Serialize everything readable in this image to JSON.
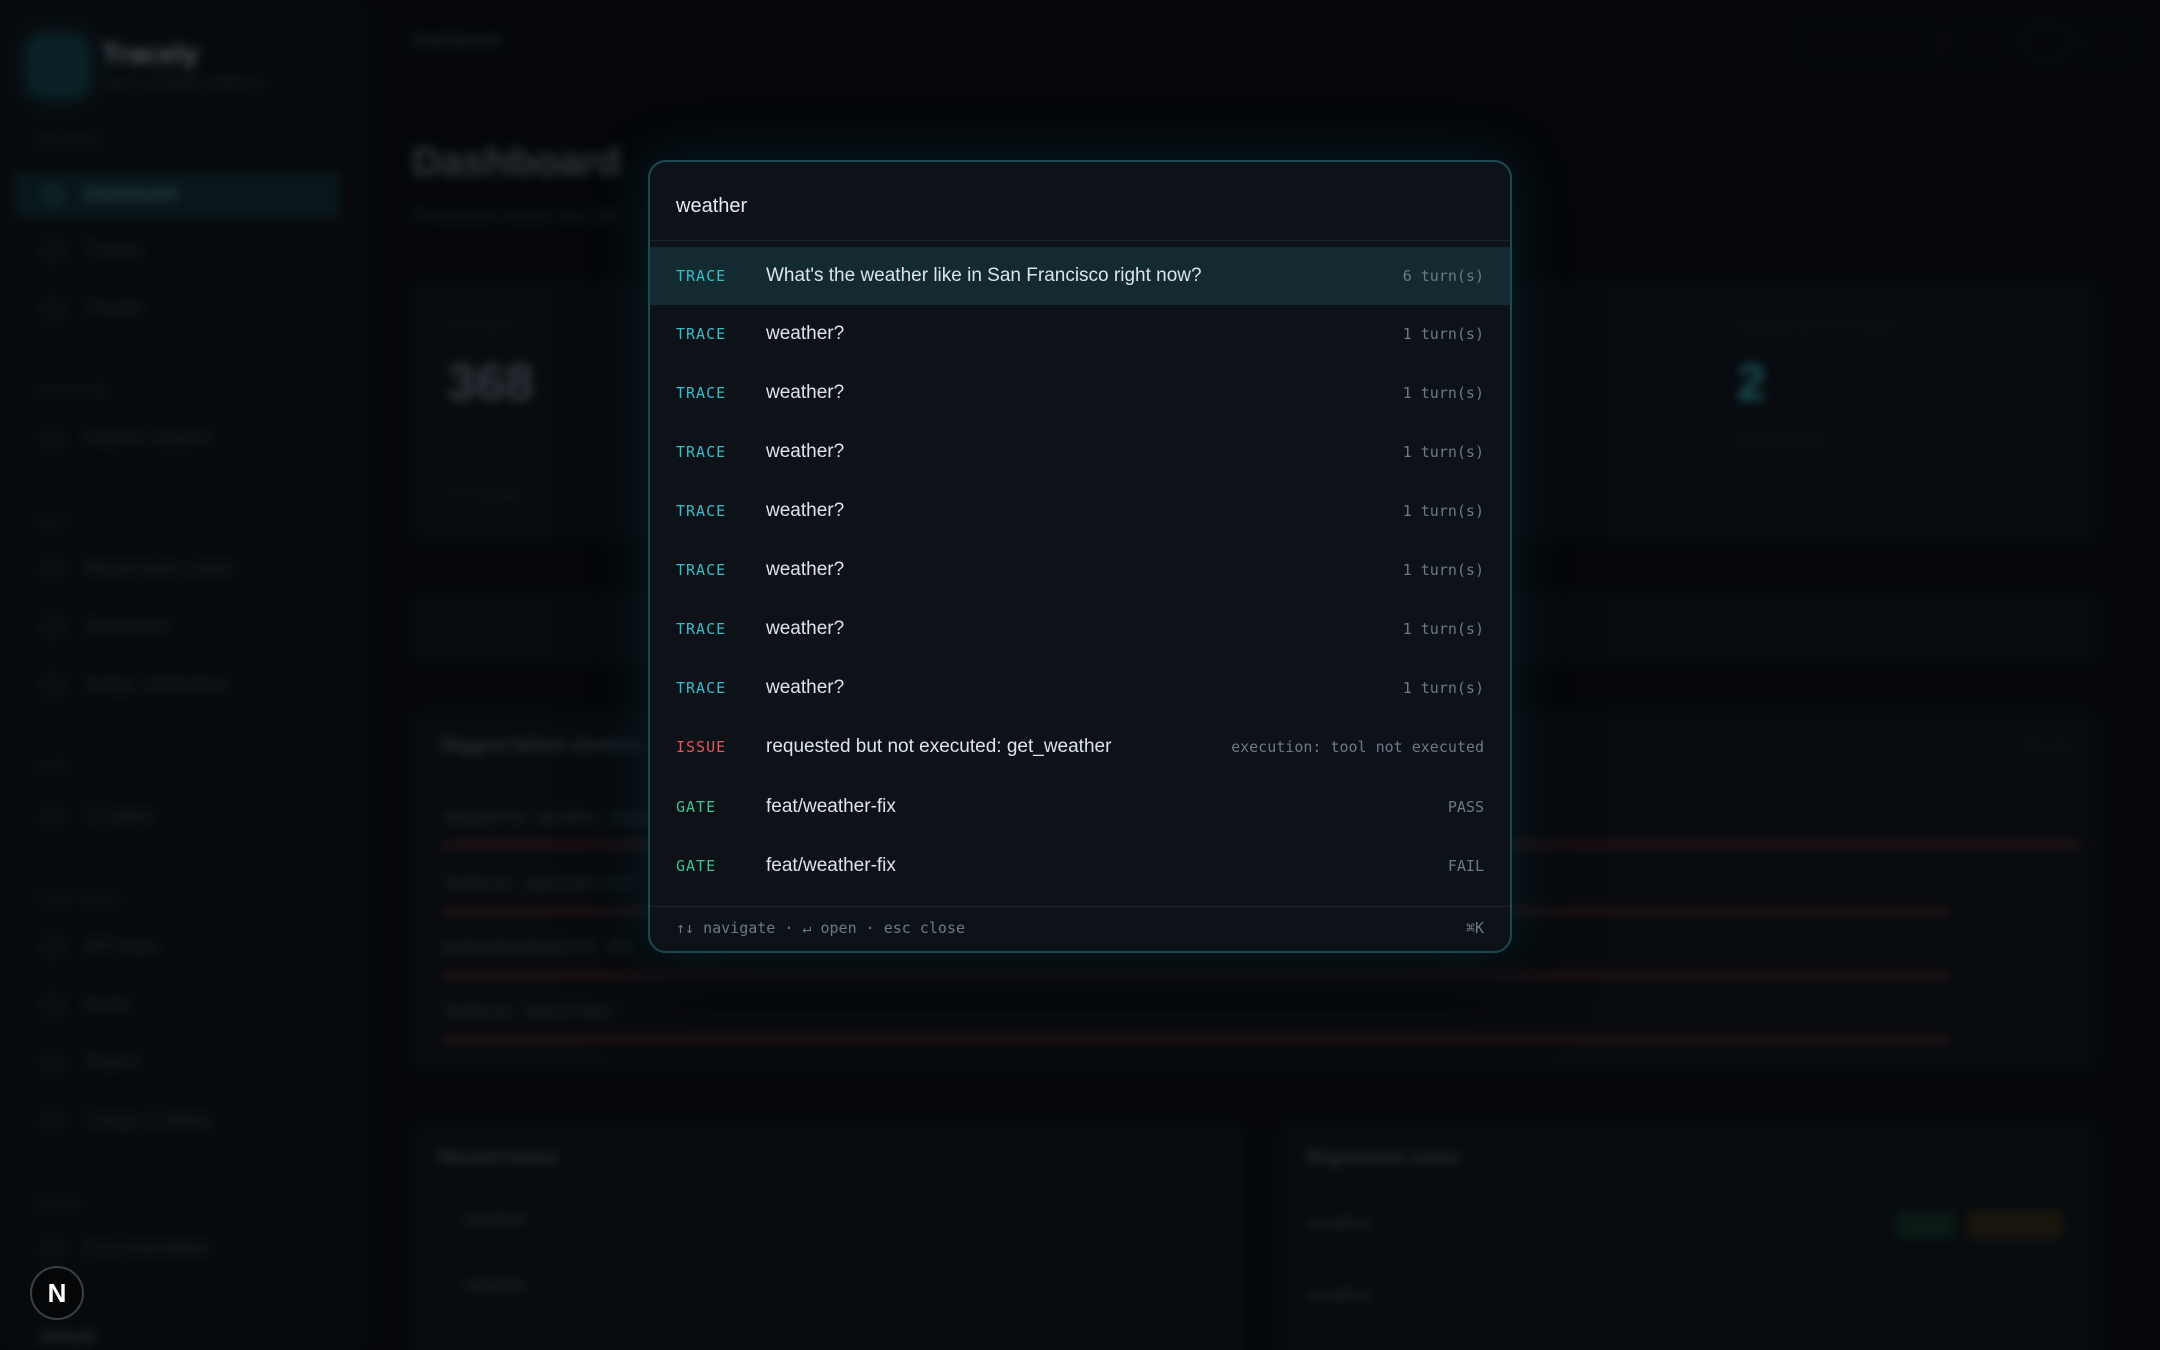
{
  "app": {
    "name": "Tracely",
    "tagline": "Agent reliability platform"
  },
  "sidebar": {
    "groups": [
      {
        "label": "OBSERVE",
        "items": [
          "Dashboard",
          "Traces",
          "Trends"
        ]
      },
      {
        "label": "DIAGNOSE",
        "items": [
          "Failure clusters"
        ]
      },
      {
        "label": "TEST",
        "items": [
          "Regression cases",
          "Scenarios",
          "Judge calibration"
        ]
      },
      {
        "label": "SHIP",
        "items": [
          "CI gates"
        ]
      },
      {
        "label": "CONFIGURE",
        "items": [
          "API keys",
          "Evals",
          "Teams",
          "Usage & billing"
        ]
      },
      {
        "label": "LEARN",
        "items": [
          "Documentation"
        ]
      }
    ],
    "user": "Default"
  },
  "header": {
    "breadcrumb": "Dashboard",
    "search_label": "Search"
  },
  "dashboard": {
    "title": "Dashboard",
    "subtitle": "Production traces last 24h",
    "stats": [
      {
        "label": "TRACES",
        "value": "368",
        "note": "375 spans"
      },
      {
        "label": "REGRESSION CASES",
        "value": "2",
        "note": "Ground truth"
      }
    ],
    "failures_title": "Biggest failure clusters",
    "view_all": "View all",
    "failures": [
      "ValueError: weather_forecast",
      "ToolError: upstream 502",
      "AuthenticationError: 401",
      "ToolError: rate limited"
    ],
    "recent_title": "Recent traces",
    "regression_title": "Regression cases",
    "recent_rows": [
      "weather",
      "weather"
    ],
    "regression_rows": [
      "weather",
      "weather"
    ]
  },
  "palette": {
    "query": "weather",
    "results": [
      {
        "tag": "TRACE",
        "text": "What's the weather like in San Francisco right now?",
        "meta": "6 turn(s)"
      },
      {
        "tag": "TRACE",
        "text": "weather?",
        "meta": "1 turn(s)"
      },
      {
        "tag": "TRACE",
        "text": "weather?",
        "meta": "1 turn(s)"
      },
      {
        "tag": "TRACE",
        "text": "weather?",
        "meta": "1 turn(s)"
      },
      {
        "tag": "TRACE",
        "text": "weather?",
        "meta": "1 turn(s)"
      },
      {
        "tag": "TRACE",
        "text": "weather?",
        "meta": "1 turn(s)"
      },
      {
        "tag": "TRACE",
        "text": "weather?",
        "meta": "1 turn(s)"
      },
      {
        "tag": "TRACE",
        "text": "weather?",
        "meta": "1 turn(s)"
      },
      {
        "tag": "ISSUE",
        "text": "requested but not executed: get_weather",
        "meta": "execution: tool not executed"
      },
      {
        "tag": "GATE",
        "text": "feat/weather-fix",
        "meta": "PASS"
      },
      {
        "tag": "GATE",
        "text": "feat/weather-fix",
        "meta": "FAIL"
      }
    ],
    "footer_hints": "↑↓ navigate · ↵ open · esc close",
    "footer_shortcut": "⌘K"
  },
  "badge": {
    "letter": "N"
  },
  "colors": {
    "trace": "#38bcc8",
    "issue": "#e2575e",
    "gate": "#3fc28e",
    "accent_border": "#1c4a52"
  }
}
